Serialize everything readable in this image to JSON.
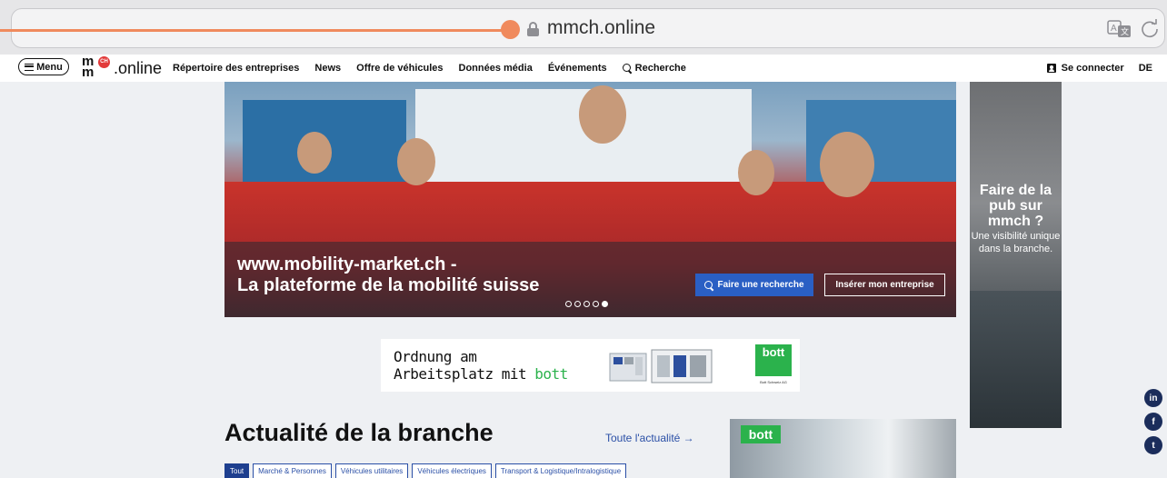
{
  "browser": {
    "url": "mmch.online"
  },
  "nav": {
    "menu_label": "Menu",
    "logo_mark": "m",
    "logo_badge": "CH",
    "logo_text": ".online",
    "links": [
      "Répertoire des entreprises",
      "News",
      "Offre de véhicules",
      "Données média",
      "Événements"
    ],
    "search_label": "Recherche",
    "login_label": "Se connecter",
    "language": "DE"
  },
  "hero": {
    "title_line1": "www.mobility-market.ch -",
    "title_line2": "La plateforme de la mobilité suisse",
    "search_button": "Faire une recherche",
    "insert_button": "Insérer mon entreprise",
    "slide_count": 5,
    "active_slide": 5
  },
  "side_ad": {
    "headline": "Faire de la pub sur mmch ?",
    "subtext": "Une visibilité unique dans la branche."
  },
  "banner_ad": {
    "line1": "Ordnung am",
    "line2_prefix": "Arbeitsplatz mit ",
    "line2_brand": "bott",
    "logo": "bott",
    "logo_sub": "Bott Schweiz AG"
  },
  "news": {
    "title": "Actualité de la branche",
    "all_link": "Toute l'actualité →",
    "filters": [
      "Tout",
      "Marché & Personnes",
      "Véhicules utilitaires",
      "Véhicules électriques",
      "Transport & Logistique/Intralogistique"
    ],
    "card_tag": "bott"
  },
  "social": {
    "icons": [
      "linkedin-icon",
      "facebook-icon",
      "twitter-icon"
    ],
    "labels": [
      "in",
      "f",
      "t"
    ]
  },
  "colors": {
    "accent_blue": "#2a5fc4",
    "progress": "#f08a5d",
    "bott_green": "#2bb24c",
    "navy": "#1b2d5b"
  }
}
